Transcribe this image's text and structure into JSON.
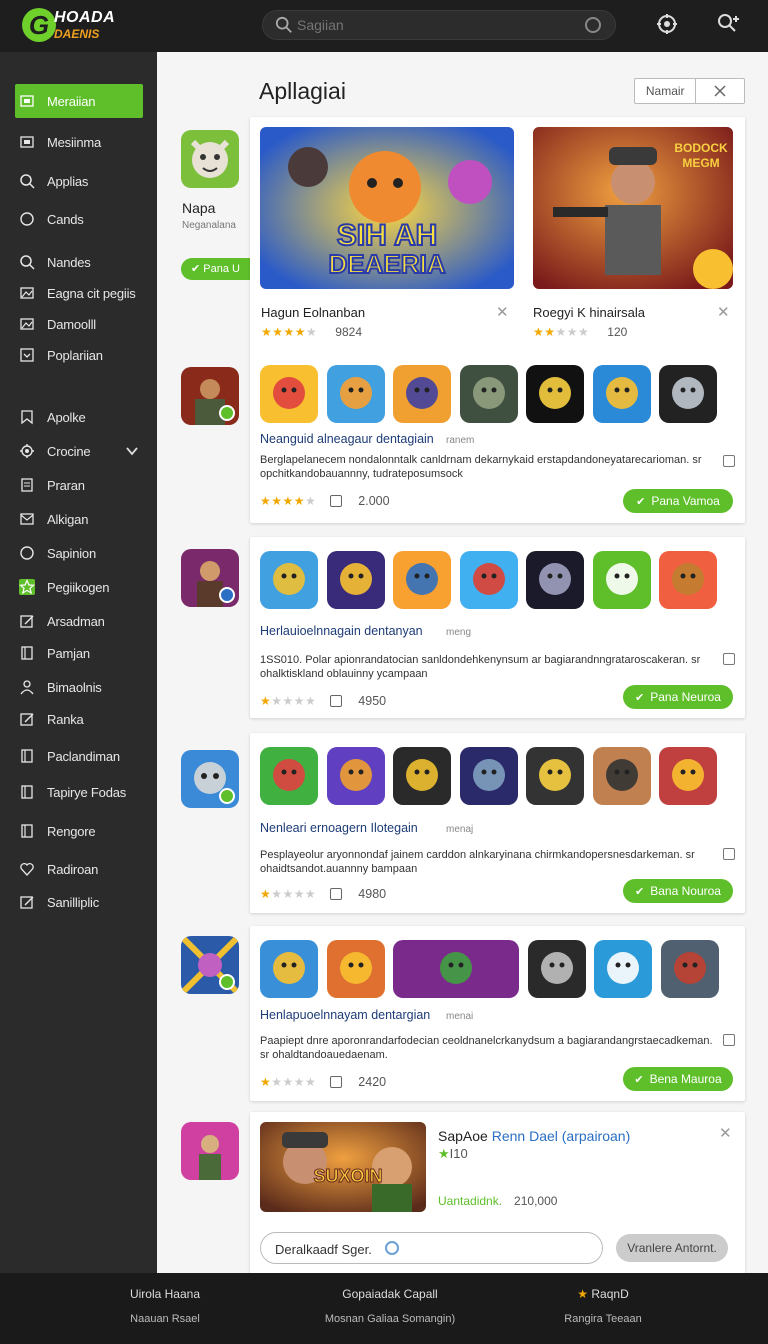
{
  "header": {
    "logo_line1": "HOADA",
    "logo_line2": "DAENIS",
    "search_placeholder": "Sagiian"
  },
  "sidebar": {
    "items": [
      {
        "label": "Meraiian",
        "icon": "square-icon",
        "active": true
      },
      {
        "label": "Mesiinma",
        "icon": "square-icon"
      },
      {
        "label": "Applias",
        "icon": "search-icon"
      },
      {
        "label": "Cands",
        "icon": "circle-icon"
      },
      {
        "label": "Nandes",
        "icon": "search-icon"
      },
      {
        "label": "Eagna cit pegiis",
        "icon": "image-icon"
      },
      {
        "label": "Damoolll",
        "icon": "image-icon"
      },
      {
        "label": "Poplariian",
        "icon": "dropdown-icon"
      },
      {
        "label": "Apolke",
        "icon": "bookmark-icon"
      },
      {
        "label": "Crocine",
        "icon": "gear-icon"
      },
      {
        "label": "Praran",
        "icon": "document-icon"
      },
      {
        "label": "Alkigan",
        "icon": "mail-icon"
      },
      {
        "label": "Sapinion",
        "icon": "circle-icon"
      },
      {
        "label": "Pegiikogen",
        "icon": "star-icon",
        "accent": true
      },
      {
        "label": "Arsadman",
        "icon": "edit-icon"
      },
      {
        "label": "Pamjan",
        "icon": "book-icon"
      },
      {
        "label": "Bimaolnis",
        "icon": "user-icon"
      },
      {
        "label": "Ranka",
        "icon": "edit-icon"
      },
      {
        "label": "Paclandiman",
        "icon": "book-icon"
      },
      {
        "label": "Tapirye Fodas",
        "icon": "book-icon"
      },
      {
        "label": "Rengore",
        "icon": "book-icon"
      },
      {
        "label": "Radiroan",
        "icon": "heart-icon"
      },
      {
        "label": "Sanilliplic",
        "icon": "edit-icon"
      }
    ]
  },
  "main": {
    "title": "Apllagiai",
    "top_button": "Namair",
    "left": {
      "name": "Napa",
      "sub": "Neganalana",
      "pill": "Pana U"
    },
    "featured": [
      {
        "title": "Hagun Eolnanban",
        "rating": 3.5,
        "count": "9824",
        "art": "SIH AH DEAERIA"
      },
      {
        "title": "Roegyi K hinairsala",
        "rating": 2,
        "count": "120",
        "art": "BODOCK MEGM"
      }
    ],
    "lists": [
      {
        "title": "Neanguid alneagaur dentagiain",
        "meta": "ranem",
        "desc": "Berglapelanecem nondalonntalk canldrnam dekarnykaid erstapdandoneyatarecarioman. sr opchitkandobauannny, tudrateposumsock",
        "rating": 3.5,
        "count": "2.000",
        "button": "Pana Vamoa"
      },
      {
        "title": "Herlauioelnnagain dentanyan",
        "meta": "meng",
        "desc": "1SS010. Polar apionrandatocian sanldondehkenynsum ar bagiarandnngrataroscakeran. sr ohalktiskland oblauinny ycampaan",
        "rating": 1,
        "count": "4950",
        "button": "Pana Neuroa"
      },
      {
        "title": "Nenleari ernoagern Ilotegain",
        "meta": "menaj",
        "desc": "Pesplayeolur aryonnondaf jainem carddon alnkaryinana chirmkandopersnesdarkeman. sr ohaidtsandot.auannny bampaan",
        "rating": 1,
        "count": "4980",
        "button": "Bana Nouroa"
      },
      {
        "title": "Henlapuoelnnayam dentargian",
        "meta": "menai",
        "desc": "Paapiept dnre aporonrandarfodecian ceoldnanelcrkanydsum a bagiarandangrstaecadkeman. sr ohaldtandoauedaenam.",
        "rating": 1,
        "count": "2420",
        "button": "Bena Mauroa"
      }
    ],
    "bottom": {
      "title": "SapAoe",
      "title_highlight": "Renn Dael",
      "title_suffix": "(arpairoan)",
      "rating": "I10",
      "meta_label": "Uantadidnk.",
      "meta_count": "210,000",
      "input_text": "Deralkaadf Sger.",
      "button": "Vranlere Antornt."
    }
  },
  "footer": {
    "col1": {
      "title": "Uirola Haana",
      "sub": "Naauan Rsael"
    },
    "col2": {
      "title": "Gopaiadak Capall",
      "sub": "Mosnan Galiaa Somangin)"
    },
    "col3": {
      "title": "RaqnD",
      "sub": "Rangira Teeaan"
    }
  },
  "colors": {
    "accent": "#5fbf2a",
    "sidebar": "#2b2b2b",
    "header": "#1e1e1e"
  }
}
